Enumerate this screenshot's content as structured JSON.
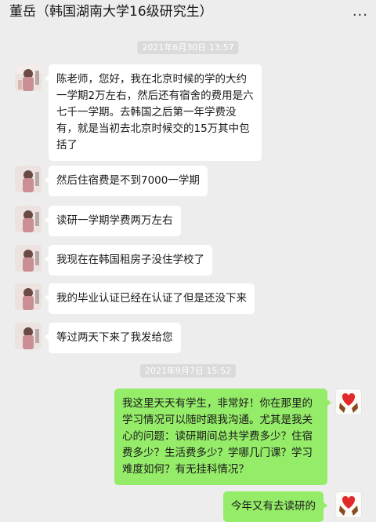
{
  "header": {
    "title": "董岳（韩国湖南大学16级研究生）",
    "more_label": "..."
  },
  "timestamps": [
    "2021年6月30日 13:57",
    "2021年9月7日 15:52"
  ],
  "messages": [
    {
      "side": "left",
      "text": "陈老师，您好，我在北京时候的学的大约一学期2万左右，然后还有宿舍的费用是六七千一学期。去韩国之后第一年学费没有，就是当初去北京时候交的15万其中包括了"
    },
    {
      "side": "left",
      "text": "然后住宿费是不到7000一学期"
    },
    {
      "side": "left",
      "text": "读研一学期学费两万左右"
    },
    {
      "side": "left",
      "text": "我现在在韩国租房子没住学校了"
    },
    {
      "side": "left",
      "text": "我的毕业认证已经在认证了但是还没下来"
    },
    {
      "side": "left",
      "text": "等过两天下来了我发给您"
    },
    {
      "side": "right",
      "text": "我这里天天有学生，非常好！你在那里的学习情况可以随时跟我沟通。尤其是我关心的问题：读研期间总共学费多少？住宿费多少？生活费多少？学哪几门课？学习难度如何？有无挂科情况？"
    },
    {
      "side": "right",
      "text": "今年又有去读研的"
    }
  ],
  "colors": {
    "background": "#ededed",
    "bubble_left": "#ffffff",
    "bubble_right": "#95ec69",
    "timestamp_bg": "#dadada"
  }
}
